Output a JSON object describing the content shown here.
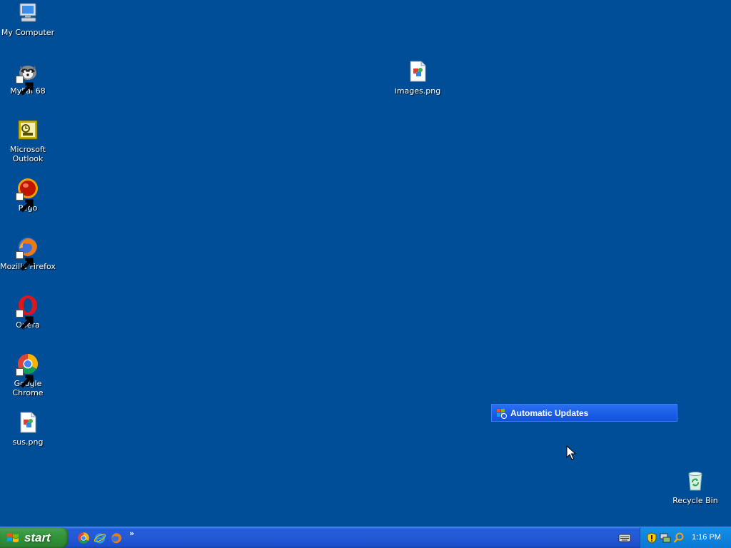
{
  "desktop": {
    "icons": [
      {
        "label": "My Computer",
        "icon": "my-computer-icon"
      },
      {
        "label": "MyPal 68",
        "icon": "mypal-icon"
      },
      {
        "label": "Microsoft Outlook",
        "icon": "outlook-icon"
      },
      {
        "label": "Pego",
        "icon": "pego-icon"
      },
      {
        "label": "Mozilla Firefox",
        "icon": "firefox-icon"
      },
      {
        "label": "Opera",
        "icon": "opera-icon"
      },
      {
        "label": "Google Chrome",
        "icon": "chrome-icon"
      },
      {
        "label": "sus.png",
        "icon": "image-file-icon"
      },
      {
        "label": "images.png",
        "icon": "image-file-icon"
      },
      {
        "label": "Recycle Bin",
        "icon": "recycle-bin-icon"
      }
    ]
  },
  "notification": {
    "title": "Automatic Updates",
    "icon": "windows-update-icon"
  },
  "taskbar": {
    "start_label": "start",
    "quick_launch": [
      "chrome-icon",
      "internet-explorer-icon",
      "firefox-icon"
    ],
    "chevron": "»",
    "tray_icons": [
      "security-shield-icon",
      "network-icon",
      "search-icon"
    ],
    "clock": "1:16 PM"
  },
  "colors": {
    "desktop_bg": "#004e98",
    "taskbar_blue": "#245edb",
    "start_green": "#3c9b45",
    "tray_blue": "#0f86e0",
    "balloon_blue": "#1a5ce8"
  }
}
